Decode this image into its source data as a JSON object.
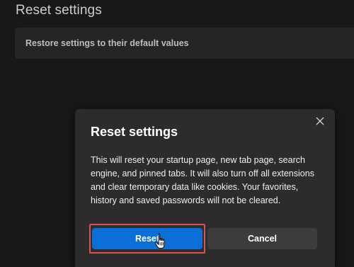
{
  "page": {
    "title": "Reset settings",
    "restore_item_label": "Restore settings to their default values"
  },
  "dialog": {
    "title": "Reset settings",
    "body": "This will reset your startup page, new tab page, search engine, and pinned tabs. It will also turn off all extensions and clear temporary data like cookies. Your favorites, history and saved passwords will not be cleared.",
    "reset_label": "Reset",
    "cancel_label": "Cancel",
    "close_icon": "close-icon"
  },
  "colors": {
    "background": "#1c1c1c",
    "card": "#2b2b2b",
    "dialog": "#2c2c2c",
    "primary_button": "#0a6fd6",
    "secondary_button": "#3c3c3c",
    "highlight_box": "#d9534f"
  }
}
